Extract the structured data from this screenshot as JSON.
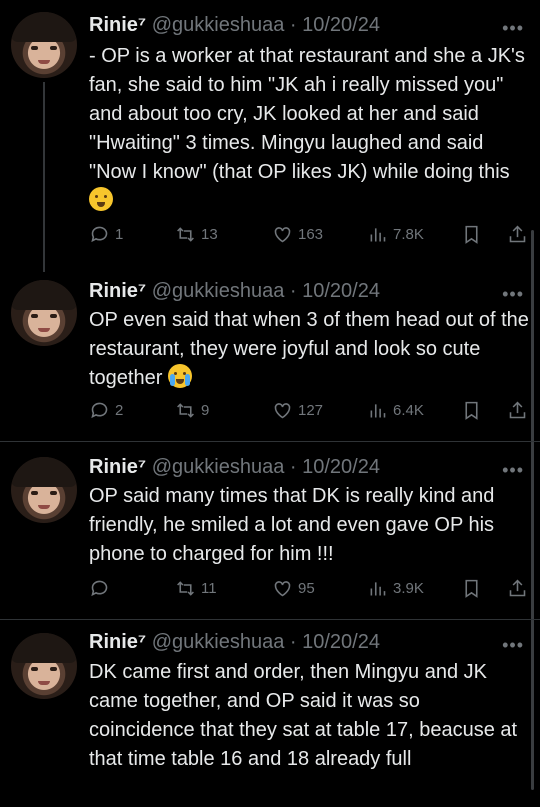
{
  "tweets": [
    {
      "name": "Rinie⁷",
      "handle": "@gukkieshuaa",
      "date": "10/20/24",
      "text": "- OP is a worker at that restaurant  and she a JK's fan, she said to him \"JK ah i really missed you\" and about too cry, JK looked at her and said \"Hwaiting\" 3 times. Mingyu laughed and said \"Now I know\" (that OP likes JK) while doing this",
      "emoji": "shushing-face",
      "replies": "1",
      "retweets": "13",
      "likes": "163",
      "views": "7.8K"
    },
    {
      "name": "Rinie⁷",
      "handle": "@gukkieshuaa",
      "date": "10/20/24",
      "text": "OP even said that when 3 of them head out of the restaurant, they were joyful and look so cute together",
      "emoji": "loudly-crying-face",
      "replies": "2",
      "retweets": "9",
      "likes": "127",
      "views": "6.4K"
    },
    {
      "name": "Rinie⁷",
      "handle": "@gukkieshuaa",
      "date": "10/20/24",
      "text": "OP said many times that DK is really kind and friendly, he smiled a lot and even gave OP his phone to charged for him !!!",
      "replies": "",
      "retweets": "11",
      "likes": "95",
      "views": "3.9K"
    },
    {
      "name": "Rinie⁷",
      "handle": "@gukkieshuaa",
      "date": "10/20/24",
      "text": "DK came first and order, then Mingyu and JK came together, and OP said it was so coincidence that they sat at table 17, beacuse at that time table 16 and 18 already full"
    }
  ],
  "separator": " · ",
  "more_label": "•••"
}
